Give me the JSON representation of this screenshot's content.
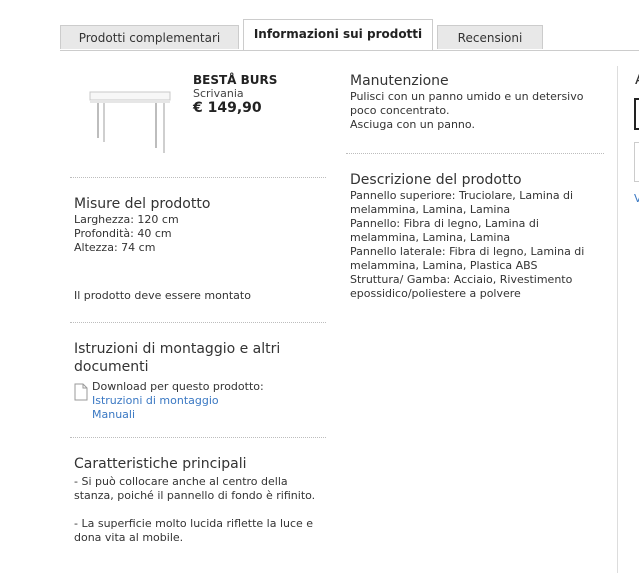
{
  "tabs": [
    {
      "label": "Prodotti complementari"
    },
    {
      "label": "Informazioni sui prodotti"
    },
    {
      "label": "Recensioni"
    }
  ],
  "product": {
    "name": "BESTÅ BURS",
    "type": "Scrivania",
    "price": "€ 149,90"
  },
  "dimensions": {
    "title": "Misure del prodotto",
    "lines": [
      "Larghezza: 120 cm",
      "Profondità: 40 cm",
      "Altezza: 74 cm"
    ],
    "assembly_note": "Il prodotto deve essere montato"
  },
  "instructions": {
    "title": "Istruzioni di montaggio e altri documenti",
    "download_label": "Download per questo prodotto:",
    "links": [
      "Istruzioni di montaggio",
      "Manuali"
    ]
  },
  "features": {
    "title": "Caratteristiche principali",
    "items": [
      "- Si può collocare anche al centro della stanza, poiché il pannello di fondo è rifinito.",
      "- La superficie molto lucida riflette la luce e dona vita al mobile."
    ]
  },
  "care": {
    "title": "Manutenzione",
    "lines": [
      "Pulisci con un panno umido e un detersivo poco concentrato.",
      "Asciuga con un panno."
    ]
  },
  "description": {
    "title": "Descrizione del prodotto",
    "lines": [
      "Pannello superiore: Truciolare, Lamina di melammina, Lamina, Lamina",
      "Pannello: Fibra di legno, Lamina di melammina, Lamina, Lamina",
      "Pannello laterale: Fibra di legno, Lamina di melammina, Lamina, Plastica ABS",
      "Struttura/ Gamba: Acciaio, Rivestimento epossidico/poliestere a polvere"
    ]
  },
  "right_panel": {
    "letter_a": "A",
    "letter_v": "V"
  },
  "icons": {
    "document": "document-icon",
    "product_image": "desk-image"
  }
}
